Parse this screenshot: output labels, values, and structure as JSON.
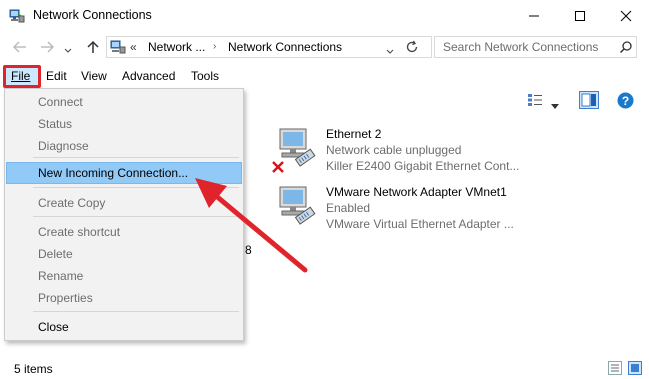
{
  "window": {
    "title": "Network Connections",
    "minimize_icon": "minimize-icon",
    "maximize_icon": "maximize-icon",
    "close_icon": "close-icon"
  },
  "nav": {
    "address_prefix": "«",
    "address_segment1": "Network ...",
    "address_segment2": "Network Connections",
    "search_placeholder": "Search Network Connections"
  },
  "menubar": {
    "file": "File",
    "edit": "Edit",
    "view": "View",
    "advanced": "Advanced",
    "tools": "Tools"
  },
  "file_menu": {
    "connect": "Connect",
    "status": "Status",
    "diagnose": "Diagnose",
    "new_incoming": "New Incoming Connection...",
    "create_copy": "Create Copy",
    "create_shortcut": "Create shortcut",
    "delete": "Delete",
    "rename": "Rename",
    "properties": "Properties",
    "close": "Close"
  },
  "connections": [
    {
      "name": "Ethernet 2",
      "status": "Network cable unplugged",
      "device": "Killer E2400 Gigabit Ethernet Cont..."
    },
    {
      "name": "VMware Network Adapter VMnet1",
      "status": "Enabled",
      "device": "VMware Virtual Ethernet Adapter ..."
    }
  ],
  "hidden_fragment": "8",
  "statusbar": {
    "items": "5 items"
  },
  "colors": {
    "highlight": "#91c9f7",
    "annotation_red": "#e0242b",
    "accent_blue": "#1979ca"
  }
}
